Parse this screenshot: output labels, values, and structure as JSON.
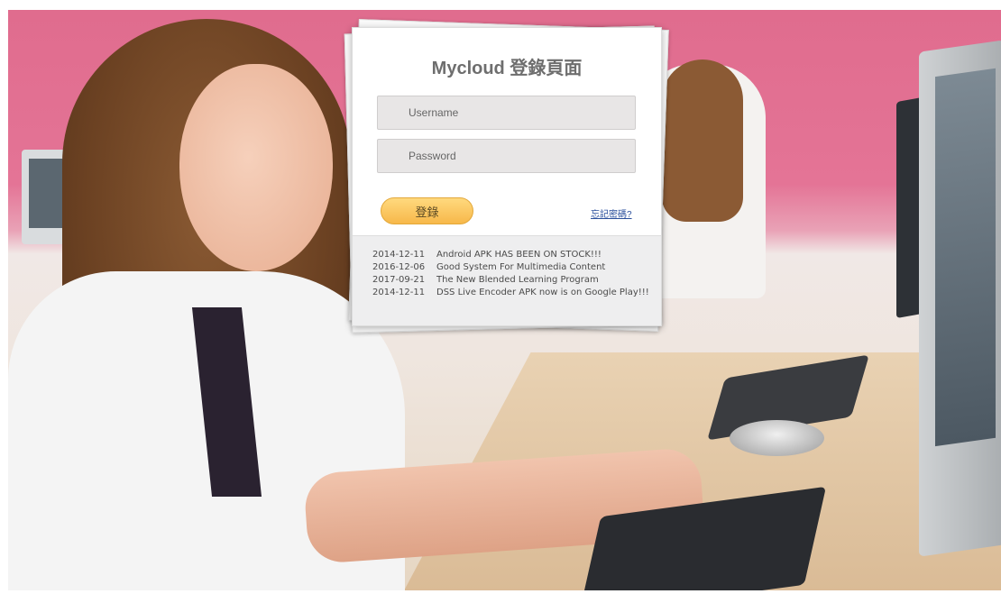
{
  "login": {
    "title": "Mycloud 登錄頁面",
    "username_placeholder": "Username",
    "password_placeholder": "Password",
    "login_button": "登錄",
    "forgot_link": "忘記密碼?"
  },
  "news": [
    {
      "date": "2014-12-11",
      "text": "Android APK HAS BEEN ON STOCK!!!"
    },
    {
      "date": "2016-12-06",
      "text": "Good System For Multimedia Content"
    },
    {
      "date": "2017-09-21",
      "text": "The New Blended Learning Program"
    },
    {
      "date": "2014-12-11",
      "text": "DSS Live Encoder APK now is on Google Play!!!"
    }
  ],
  "colors": {
    "background_wall": "#e47496",
    "button_accent": "#f7b84a",
    "link": "#2a4f9c"
  }
}
